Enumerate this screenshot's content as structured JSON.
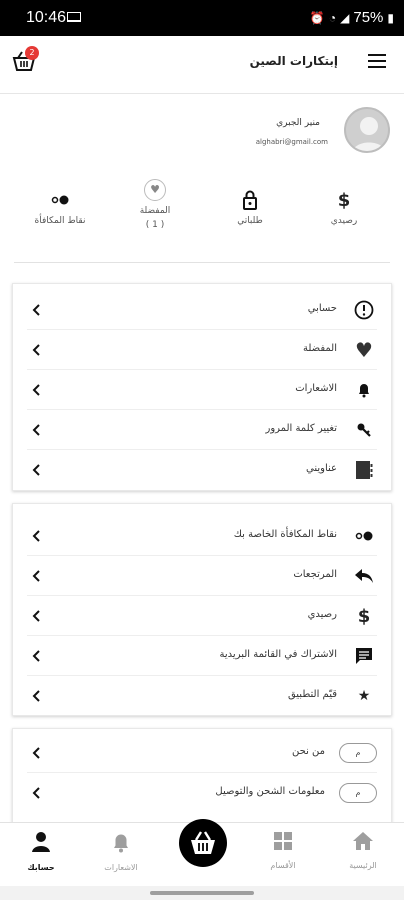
{
  "status_bar": {
    "time": "10:46",
    "battery": "75%"
  },
  "app_bar": {
    "title": "إبتكارات الصين",
    "cart_badge": "2"
  },
  "profile": {
    "name": "منير الجبري",
    "email": "alghabri@gmail.com"
  },
  "stats": [
    {
      "id": "receipts",
      "label": "رصيدي",
      "icon": "dollar-icon"
    },
    {
      "id": "orders",
      "label": "طلباتي",
      "icon": "lock-icon"
    },
    {
      "id": "favorites",
      "label": "المفضلة",
      "count": "( 1 )",
      "icon": "heart-icon"
    },
    {
      "id": "points",
      "label": "نقاط المكافأة",
      "icon": "toggle-icon"
    }
  ],
  "section1": [
    {
      "label": "حسابي",
      "icon": "info-icon"
    },
    {
      "label": "المفضلة",
      "icon": "heart-icon"
    },
    {
      "label": "الاشعارات",
      "icon": "bell-icon"
    },
    {
      "label": "تغيير كلمة المرور",
      "icon": "key-icon"
    },
    {
      "label": "عناويني",
      "icon": "address-book-icon"
    }
  ],
  "section2": [
    {
      "label": "نقاط المكافأة الخاصة بك",
      "icon": "toggle-icon"
    },
    {
      "label": "المرتجعات",
      "icon": "reply-icon"
    },
    {
      "label": "رصيدي",
      "icon": "dollar-icon"
    },
    {
      "label": "الاشتراك في القائمة البريدية",
      "icon": "message-icon"
    },
    {
      "label": "قيّم التطبيق",
      "icon": "star-icon"
    }
  ],
  "section3": [
    {
      "label": "من نحن",
      "pill": "م"
    },
    {
      "label": "معلومات الشحن والتوصيل",
      "pill": "م"
    }
  ],
  "bottom_nav": {
    "home": "الرئيسية",
    "categories": "الأقسام",
    "notifications": "الاشعارات",
    "account": "حسابك"
  }
}
